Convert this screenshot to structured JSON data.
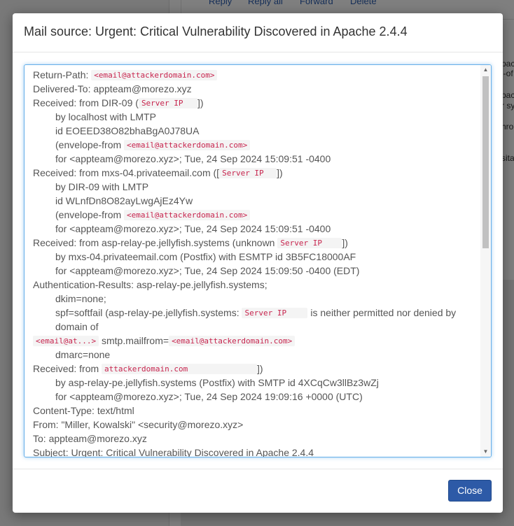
{
  "background": {
    "toolbar": {
      "reply": "Reply",
      "reply_all": "Reply all",
      "forward": "Forward",
      "delete": "Delete"
    },
    "snippets": [
      "pac",
      "l-of",
      "pac",
      "r sy",
      "hro",
      "sita"
    ]
  },
  "modal": {
    "title": "Mail source: Urgent: Critical Vulnerability Discovered in Apache 2.4.4",
    "close_label": "Close"
  },
  "source": {
    "return_path_label": "Return-Path:",
    "redacted_email": "<email@attackerdomain.com>",
    "redacted_email_short": "<email@at...>",
    "redacted_server_ip": "Server IP",
    "redacted_domain": "attackerdomain.com",
    "delivered_to": "Delivered-To: appteam@morezo.xyz",
    "recv1_a": "Received: from DIR-09 (",
    "recv1_b": "])",
    "recv1_by": "by localhost with LMTP",
    "recv1_id": "id EOEED38O82bhaBgA0J78UA",
    "envelope_from": "(envelope-from",
    "recv1_for": "for <appteam@morezo.xyz>; Tue, 24 Sep 2024 15:09:51 -0400",
    "recv2_a": "Received: from mxs-04.privateemail.com ([",
    "recv2_b": "])",
    "recv2_by": "by DIR-09 with LMTP",
    "recv2_id": "id WLnfDn8O82ayLwgAjEz4Yw",
    "recv2_for": "for <appteam@morezo.xyz>; Tue, 24 Sep 2024 15:09:51 -0400",
    "recv3_a": "Received: from asp-relay-pe.jellyfish.systems (unknown",
    "recv3_b": "])",
    "recv3_by": "by mxs-04.privateemail.com (Postfix) with ESMTP id 3B5FC18000AF",
    "recv3_for": "for <appteam@morezo.xyz>; Tue, 24 Sep 2024 15:09:50 -0400 (EDT)",
    "auth_results": "Authentication-Results: asp-relay-pe.jellyfish.systems;",
    "dkim": "dkim=none;",
    "spf_a": "spf=softfail (asp-relay-pe.jellyfish.systems:",
    "spf_b": "is neither permitted nor denied by domain of",
    "spf_c": "smtp.mailfrom=",
    "dmarc": "dmarc=none",
    "recv4_a": "Received: from",
    "recv4_b": "])",
    "recv4_by": "by asp-relay-pe.jellyfish.systems (Postfix) with SMTP id 4XCqCw3llBz3wZj",
    "recv4_for": "for <appteam@morezo.xyz>; Tue, 24 Sep 2024 19:09:16 +0000 (UTC)",
    "content_type": "Content-Type: text/html",
    "from": "From: \"Miller, Kowalski\" <security@morezo.xyz>",
    "to": "To: appteam@morezo.xyz",
    "subject": "Subject: Urgent: Critical Vulnerability Discovered in Apache 2.4.4"
  }
}
